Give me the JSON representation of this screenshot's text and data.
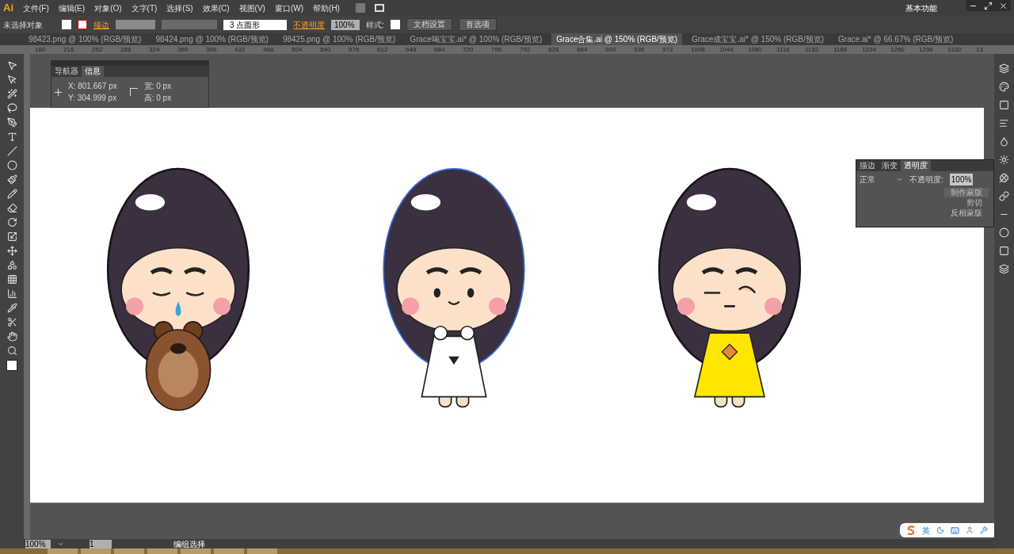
{
  "app": {
    "logo": "Ai",
    "workspace": "基本功能"
  },
  "menu": [
    "文件(F)",
    "编辑(E)",
    "对象(O)",
    "文字(T)",
    "选择(S)",
    "效果(C)",
    "视图(V)",
    "窗口(W)",
    "帮助(H)"
  ],
  "control_bar": {
    "selection": "未选择对象",
    "stroke_label": "描边",
    "brush": "3 点圆形",
    "opacity_label": "不透明度",
    "opacity": "100%",
    "style_label": "样式:",
    "buttons": [
      "文档设置",
      "首选项"
    ]
  },
  "tabs": [
    {
      "label": "98423.png @ 100% (RGB/预览)",
      "selected": false
    },
    {
      "label": "98424.png @ 100% (RGB/预览)",
      "selected": false
    },
    {
      "label": "98425.png @ 100% (RGB/预览)",
      "selected": false
    },
    {
      "label": "Grace喝宝宝.ai* @ 100% (RGB/预览)",
      "selected": false
    },
    {
      "label": "Grace合集.ai @ 150% (RGB/预览)",
      "selected": true
    },
    {
      "label": "Grace成宝宝.ai* @ 150% (RGB/预览)",
      "selected": false
    },
    {
      "label": "Grace.ai* @ 66.67% (RGB/预览)",
      "selected": false
    }
  ],
  "ruler": [
    "180",
    "216",
    "252",
    "288",
    "324",
    "360",
    "396",
    "432",
    "468",
    "504",
    "540",
    "576",
    "612",
    "648",
    "684",
    "720",
    "756",
    "792",
    "828",
    "864",
    "900",
    "936",
    "972",
    "1008",
    "1044",
    "1080",
    "1116",
    "1152",
    "1188",
    "1224",
    "1260",
    "1296",
    "1332",
    "13"
  ],
  "info_panel": {
    "tabs": [
      {
        "label": "导航器",
        "selected": false
      },
      {
        "label": "信息",
        "selected": true
      }
    ],
    "x": "X: 801.667 px",
    "y": "Y: 304.999 px",
    "w": "宽: 0 px",
    "h": "高: 0 px"
  },
  "transparency_panel": {
    "tabs": [
      {
        "label": "描边",
        "selected": false
      },
      {
        "label": "渐变",
        "selected": false
      },
      {
        "label": "透明度",
        "selected": true
      }
    ],
    "blend": "正常",
    "opacity_label": "不透明度:",
    "opacity": "100%",
    "buttons": [
      "制作蒙版",
      "剪切",
      "反相蒙版"
    ]
  },
  "characters": [
    {
      "kind": "bear",
      "selected": false
    },
    {
      "kind": "white-dress",
      "selected": true
    },
    {
      "kind": "yellow-dress",
      "selected": false
    }
  ],
  "status_bar": {
    "zoom": "100%",
    "page": "1",
    "tool": "编组选择"
  },
  "ime": {
    "mode": "英"
  }
}
